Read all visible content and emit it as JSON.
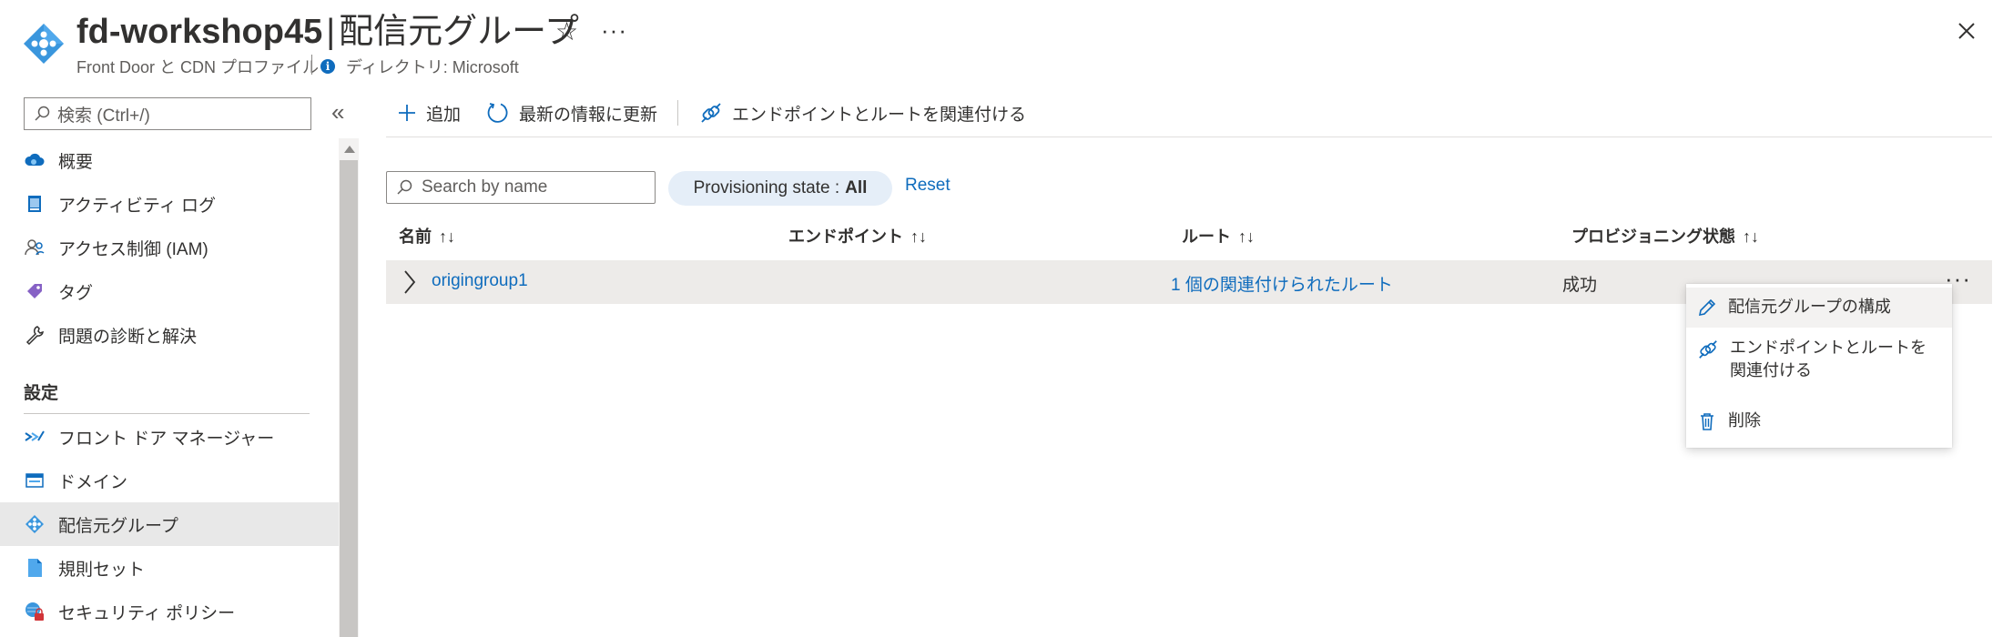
{
  "header": {
    "resource_name": "fd-workshop45",
    "separator": "|",
    "page_name": "配信元グループ",
    "subtitle": "Front Door と CDN プロファイル",
    "directory": "ディレクトリ: Microsoft",
    "more": "···"
  },
  "sidebar": {
    "search_placeholder": "検索 (Ctrl+/)",
    "collapse": "«",
    "items": [
      {
        "label": "概要",
        "icon": "cloud-icon"
      },
      {
        "label": "アクティビティ ログ",
        "icon": "activity-log-icon"
      },
      {
        "label": "アクセス制御 (IAM)",
        "icon": "people-icon"
      },
      {
        "label": "タグ",
        "icon": "tag-icon"
      },
      {
        "label": "問題の診断と解決",
        "icon": "wrench-icon"
      }
    ],
    "section_title": "設定",
    "settings_items": [
      {
        "label": "フロント ドア マネージャー",
        "icon": "front-door-icon"
      },
      {
        "label": "ドメイン",
        "icon": "domain-icon"
      },
      {
        "label": "配信元グループ",
        "icon": "origin-group-icon",
        "selected": true
      },
      {
        "label": "規則セット",
        "icon": "document-icon"
      },
      {
        "label": "セキュリティ ポリシー",
        "icon": "security-icon"
      }
    ]
  },
  "toolbar": {
    "add_label": "追加",
    "refresh_label": "最新の情報に更新",
    "associate_label": "エンドポイントとルートを関連付ける"
  },
  "filters": {
    "search_placeholder": "Search by name",
    "pill_label": "Provisioning state :",
    "pill_value": "All",
    "reset_label": "Reset"
  },
  "table": {
    "columns": [
      "名前",
      "エンドポイント",
      "ルート",
      "プロビジョニング状態"
    ],
    "sort_glyph": "↑↓",
    "rows": [
      {
        "name": "origingroup1",
        "endpoint": "",
        "route": "1 個の関連付けられたルート",
        "state": "成功"
      }
    ],
    "row_more": "···"
  },
  "context_menu": {
    "items": [
      {
        "label": "配信元グループの構成",
        "icon": "pencil-icon"
      },
      {
        "label": "エンドポイントとルートを関連付ける",
        "icon": "link-icon"
      },
      {
        "label": "削除",
        "icon": "trash-icon"
      }
    ]
  },
  "colors": {
    "accent": "#0f6cbd",
    "selected_bg": "#e8e8e8",
    "row_bg": "#edebe9",
    "pill_bg": "#e5eef8"
  }
}
